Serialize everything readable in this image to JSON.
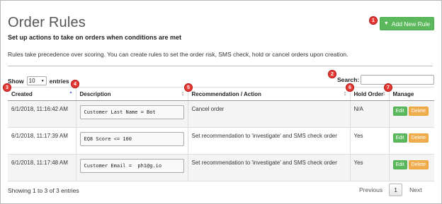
{
  "page": {
    "title": "Order Rules",
    "subtitle": "Set up actions to take on orders when conditions are met",
    "description": "Rules take precedence over scoring. You can create rules to set the order risk, SMS check, hold or cancel orders upon creation."
  },
  "add_button": {
    "label": "Add New Rule",
    "icon": "filter-icon"
  },
  "length_menu": {
    "prefix": "Show",
    "value": "10",
    "suffix": "entries"
  },
  "search": {
    "label": "Search:",
    "value": ""
  },
  "table": {
    "columns": [
      "Created",
      "Description",
      "Recommendation / Action",
      "Hold Order",
      "Manage"
    ],
    "rows": [
      {
        "created": "6/1/2018, 11:16:42 AM",
        "description": "Customer Last Name = Bot",
        "action": "Cancel order",
        "hold": "N/A",
        "edit": "Edit",
        "delete": "Delete"
      },
      {
        "created": "6/1/2018, 11:17:39 AM",
        "description": "EQ8 Score <= 100",
        "action": "Set recommendation to 'investigate' and SMS check order",
        "hold": "Yes",
        "edit": "Edit",
        "delete": "Delete"
      },
      {
        "created": "6/1/2018, 11:17:48 AM",
        "description": "Customer Email =  ph1@g.io",
        "action": "Set recommendation to 'investigate' and SMS check order",
        "hold": "Yes",
        "edit": "Edit",
        "delete": "Delete"
      }
    ]
  },
  "footer": {
    "info": "Showing 1 to 3 of 3 entries"
  },
  "pagination": {
    "previous": "Previous",
    "current": "1",
    "next": "Next"
  },
  "annotations": [
    "1",
    "2",
    "3",
    "4",
    "5",
    "6",
    "7"
  ],
  "colors": {
    "green": "#5cb85c",
    "orange": "#f0ad4e",
    "badge_red": "#e53935",
    "sort_active": "#5867c4"
  }
}
